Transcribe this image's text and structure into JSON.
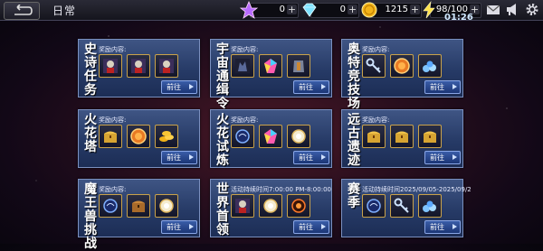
{
  "header": {
    "title": "日常",
    "time": "01:26"
  },
  "resources": {
    "crystal": {
      "value": "0",
      "icon": "star-crystal-icon"
    },
    "diamond": {
      "value": "0",
      "icon": "diamond-icon"
    },
    "gold": {
      "value": "1215",
      "icon": "gold-coin-icon"
    },
    "energy": {
      "value": "98/100",
      "icon": "lightning-icon"
    }
  },
  "icons": {
    "mail": "mail-icon",
    "announcement": "megaphone-icon",
    "settings": "gear-icon"
  },
  "colors": {
    "gold_border": "#c9a24a",
    "card_bg": "#263a66",
    "button": "#1b3575"
  },
  "cards": [
    {
      "name": "史诗任务",
      "label": "奖励内容:",
      "button": "前往",
      "items": [
        "hero-card-icon",
        "hero-card-icon",
        "hero-card-icon"
      ]
    },
    {
      "name": "宇宙通缉令",
      "label": "奖励内容:",
      "button": "前往",
      "items": [
        "monster-card-icon",
        "rainbow-gem-icon",
        "armor-icon"
      ]
    },
    {
      "name": "奥特竞技场",
      "label": "奖励内容:",
      "button": "前往",
      "items": [
        "key-icon",
        "medal-icon",
        "crystal-pile-icon"
      ]
    },
    {
      "name": "火花塔",
      "label": "奖励内容:",
      "button": "前往",
      "items": [
        "treasure-chest-icon",
        "medal-icon",
        "gold-coins-icon"
      ]
    },
    {
      "name": "火花试炼",
      "label": "奖励内容:",
      "button": "前往",
      "items": [
        "blue-orb-icon",
        "rainbow-gem-icon",
        "glowing-orb-icon"
      ]
    },
    {
      "name": "远古遗迹",
      "label": "奖励内容:",
      "button": "前往",
      "items": [
        "treasure-chest-icon",
        "treasure-chest-icon",
        "treasure-chest-icon"
      ]
    },
    {
      "name": "魔王兽挑战",
      "label": "奖励内容:",
      "button": "前往",
      "items": [
        "blue-orb-icon",
        "bronze-chest-icon",
        "glowing-orb-icon"
      ]
    },
    {
      "name": "世界首领",
      "label": "活动持续时间7:00:00 PM-8:00:00",
      "button": "前往",
      "items": [
        "hero-card-icon",
        "glowing-orb-icon",
        "fire-orb-icon"
      ]
    },
    {
      "name": "赛季",
      "label": "活动持续时间2025/09/05-2025/09/2",
      "button": "前往",
      "items": [
        "blue-orb-icon",
        "key-icon",
        "crystal-pile-icon"
      ]
    }
  ]
}
